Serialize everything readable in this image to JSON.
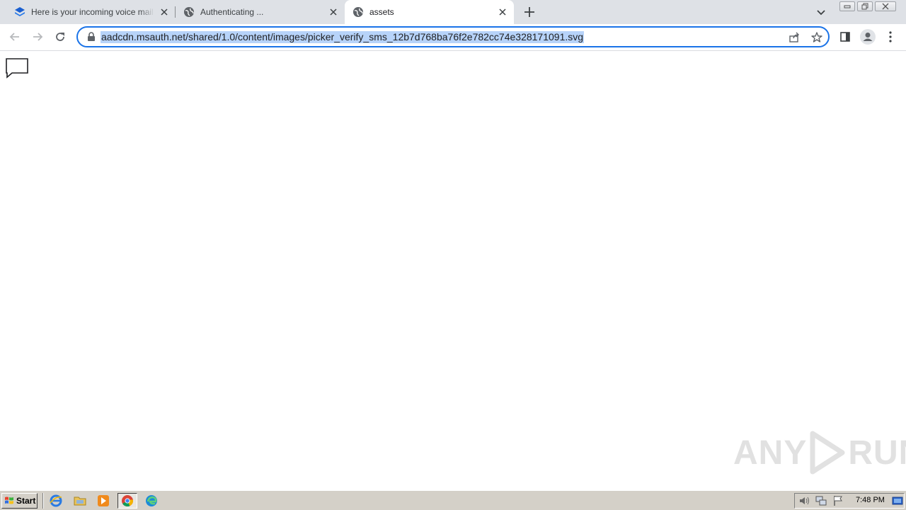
{
  "browser": {
    "tabs": [
      {
        "title": "Here is your incoming voice mail info",
        "active": false,
        "icon": "layers-icon"
      },
      {
        "title": "Authenticating ...",
        "active": false,
        "icon": "globe-icon"
      },
      {
        "title": "assets",
        "active": true,
        "icon": "globe-icon"
      }
    ],
    "address_bar": {
      "url": "aadcdn.msauth.net/shared/1.0/content/images/picker_verify_sms_12b7d768ba76f2e782cc74e328171091.svg",
      "selected": true
    },
    "accent_color": "#1a73e8"
  },
  "page": {
    "content_icon": "speech-bubble-icon"
  },
  "watermark": {
    "left_text": "ANY",
    "right_text": "RUN"
  },
  "taskbar": {
    "start_label": "Start",
    "clock": "7:48 PM",
    "quick_launch": [
      "ie-icon",
      "folder-icon",
      "media-player-icon",
      "chrome-icon",
      "edge-icon"
    ]
  }
}
